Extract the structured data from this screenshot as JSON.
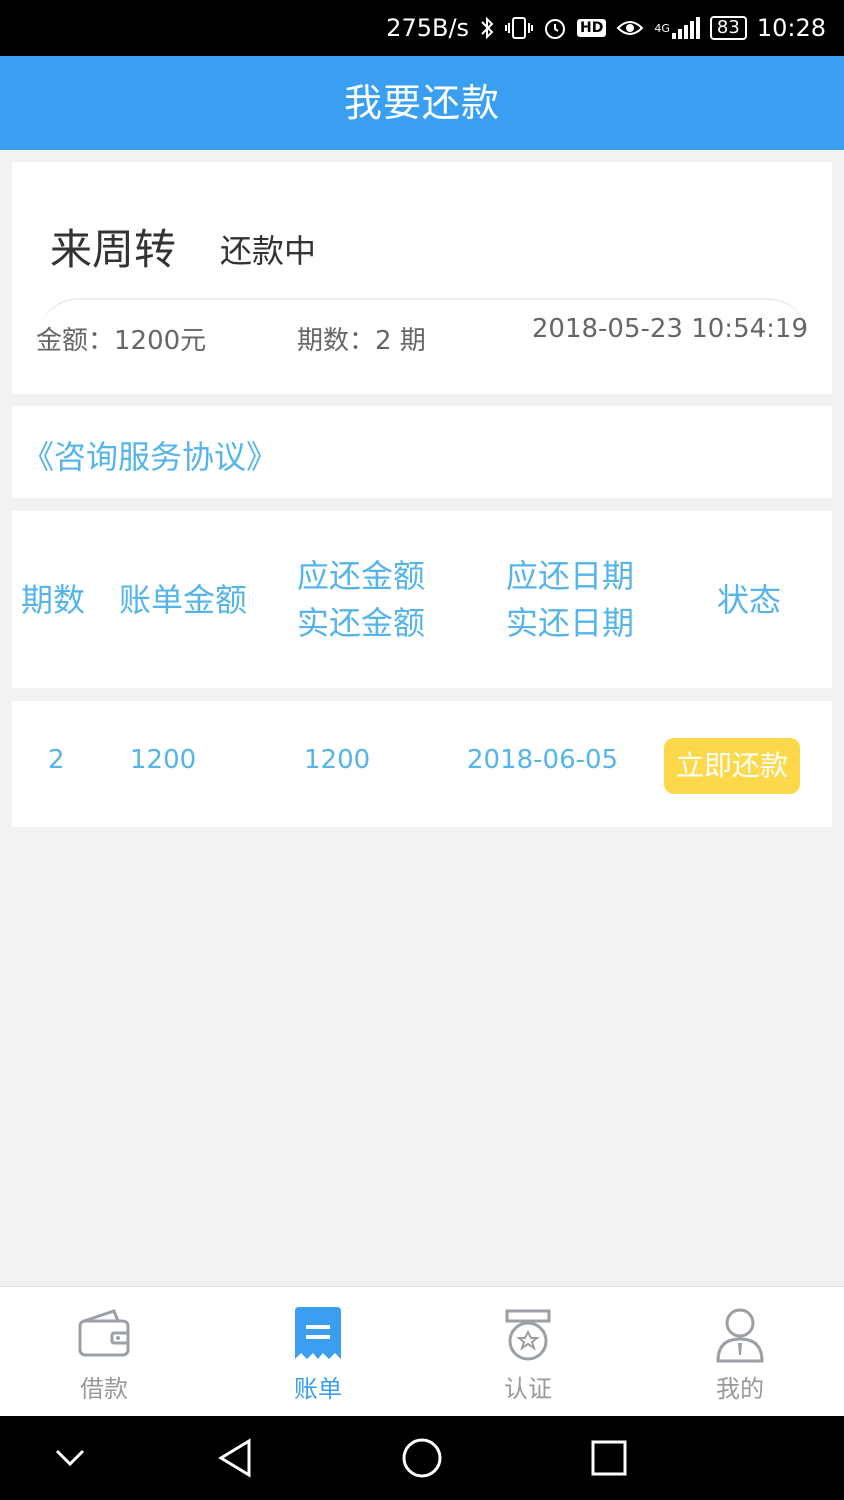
{
  "status_bar": {
    "speed": "275B/s",
    "network": "4G",
    "battery": "83",
    "time": "10:28"
  },
  "header": {
    "title": "我要还款"
  },
  "loan": {
    "name": "来周转",
    "status": "还款中",
    "amount_label": "金额：1200元",
    "periods_label": "期数：2 期",
    "datetime": "2018-05-23 10:54:19"
  },
  "agreement": {
    "link_text": "《咨询服务协议》"
  },
  "table": {
    "headers": {
      "period": "期数",
      "bill_amount": "账单金额",
      "due_amount": "应还金额",
      "paid_amount": "实还金额",
      "due_date": "应还日期",
      "paid_date": "实还日期",
      "status": "状态"
    },
    "rows": [
      {
        "period": "2",
        "bill_amount": "1200",
        "due_amount": "1200",
        "due_date": "2018-06-05",
        "action": "立即还款"
      }
    ]
  },
  "tabs": [
    {
      "label": "借款",
      "icon": "wallet-icon",
      "active": false
    },
    {
      "label": "账单",
      "icon": "bill-icon",
      "active": true
    },
    {
      "label": "认证",
      "icon": "certification-badge-icon",
      "active": false
    },
    {
      "label": "我的",
      "icon": "user-icon",
      "active": false
    }
  ],
  "colors": {
    "primary": "#3a9ff0",
    "link": "#55b4ea",
    "button": "#fdd84a",
    "background": "#f2f2f2"
  }
}
